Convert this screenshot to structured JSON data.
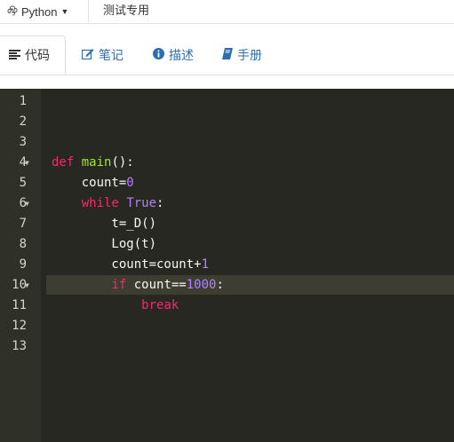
{
  "topbar": {
    "language": "Python",
    "test_link": "测试专用"
  },
  "tabs": [
    {
      "label": "代码",
      "icon": "align-left-icon"
    },
    {
      "label": "笔记",
      "icon": "edit-icon"
    },
    {
      "label": "描述",
      "icon": "info-icon"
    },
    {
      "label": "手册",
      "icon": "book-icon"
    }
  ],
  "editor": {
    "line_numbers": [
      "1",
      "2",
      "3",
      "4",
      "5",
      "6",
      "7",
      "8",
      "9",
      "10",
      "11",
      "12",
      "13"
    ],
    "lines": [
      "",
      "",
      "",
      "def main():",
      "    count=0",
      "    while True:",
      "        t=_D()",
      "        Log(t)",
      "        count=count+1",
      "        if count==1000:",
      "            break",
      "",
      ""
    ],
    "theme_colors": {
      "background": "#272822",
      "keyword": "#f92672",
      "function": "#a6e22e",
      "number": "#ae81ff"
    }
  }
}
